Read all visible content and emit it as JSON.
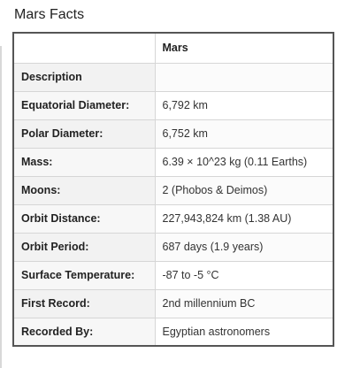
{
  "title": "Mars Facts",
  "table": {
    "header": [
      "",
      "Mars"
    ],
    "rows": [
      {
        "label": "Description",
        "value": ""
      },
      {
        "label": "Equatorial Diameter:",
        "value": "6,792 km"
      },
      {
        "label": "Polar Diameter:",
        "value": "6,752 km"
      },
      {
        "label": "Mass:",
        "value": "6.39 × 10^23 kg (0.11 Earths)"
      },
      {
        "label": "Moons:",
        "value": "2 (Phobos & Deimos)"
      },
      {
        "label": "Orbit Distance:",
        "value": "227,943,824 km (1.38 AU)"
      },
      {
        "label": "Orbit Period:",
        "value": "687 days (1.9 years)"
      },
      {
        "label": "Surface Temperature:",
        "value": "-87 to -5 °C"
      },
      {
        "label": "First Record:",
        "value": "2nd millennium BC"
      },
      {
        "label": "Recorded By:",
        "value": "Egyptian astronomers"
      }
    ]
  }
}
